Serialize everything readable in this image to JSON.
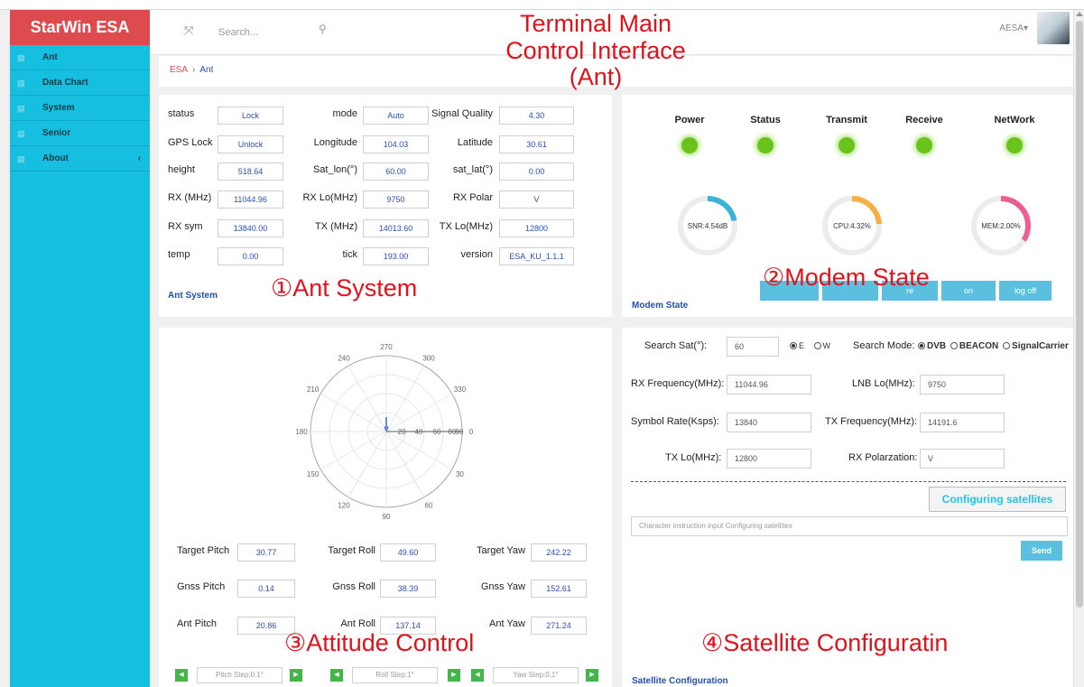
{
  "sidebar": {
    "brand": "StarWin ESA",
    "items": [
      {
        "label": "Ant"
      },
      {
        "label": "Data Chart"
      },
      {
        "label": "System"
      },
      {
        "label": "Senior"
      },
      {
        "label": "About",
        "chevron": "‹"
      }
    ]
  },
  "header": {
    "search_placeholder": "Search...",
    "user": "AESA▾"
  },
  "breadcrumb": {
    "root": "ESA",
    "separator": "›",
    "current": "Ant"
  },
  "annotations": {
    "title_line1": "Terminal Main",
    "title_line2": "Control Interface",
    "title_line3": "(Ant)",
    "ant_system": "①Ant System",
    "modem_state": "②Modem State",
    "attitude_control": "③Attitude Control",
    "satellite_config": "④Satellite Configuratin"
  },
  "ant_system": {
    "title": "Ant System",
    "rows": [
      [
        {
          "label": "status",
          "value": "Lock"
        },
        {
          "label": "mode",
          "value": "Auto"
        },
        {
          "label": "Signal Quality",
          "value": "4.30"
        }
      ],
      [
        {
          "label": "GPS Lock",
          "value": "Unlock"
        },
        {
          "label": "Longitude",
          "value": "104.03"
        },
        {
          "label": "Latitude",
          "value": "30.61"
        }
      ],
      [
        {
          "label": "height",
          "value": "518.64"
        },
        {
          "label": "Sat_lon(°)",
          "value": "60.00"
        },
        {
          "label": "sat_lat(°)",
          "value": "0.00"
        }
      ],
      [
        {
          "label": "RX (MHz)",
          "value": "11044.96"
        },
        {
          "label": "RX Lo(MHz)",
          "value": "9750"
        },
        {
          "label": "RX Polar",
          "value": "V"
        }
      ],
      [
        {
          "label": "RX sym",
          "value": "13840.00"
        },
        {
          "label": "TX (MHz)",
          "value": "14013.60"
        },
        {
          "label": "TX Lo(MHz)",
          "value": "12800"
        }
      ],
      [
        {
          "label": "temp",
          "value": "0.00"
        },
        {
          "label": "tick",
          "value": "193.00"
        },
        {
          "label": "version",
          "value": "ESA_KU_1.1.1"
        }
      ]
    ]
  },
  "modem_state": {
    "title": "Modem State",
    "indicators": [
      "Power",
      "Status",
      "Transmit",
      "Receive",
      "NetWork"
    ],
    "indicator_color": "#6ac31b",
    "gauges": [
      {
        "label": "SNR:4.54dB",
        "fraction": 0.22,
        "color": "#3bb3d8"
      },
      {
        "label": "CPU:4.32%",
        "fraction": 0.24,
        "color": "#f4b042"
      },
      {
        "label": "MEM:2.00%",
        "fraction": 0.34,
        "color": "#ec5f95"
      }
    ],
    "buttons": [
      "",
      "",
      "re",
      "on",
      "log off"
    ]
  },
  "attitude": {
    "polar_angles": [
      "270",
      "300",
      "330",
      "0",
      "30",
      "60",
      "90",
      "120",
      "150",
      "180",
      "210",
      "240"
    ],
    "radial_ticks": [
      "20",
      "40",
      "60",
      "80",
      "90"
    ],
    "rows": [
      [
        {
          "label": "Target Pitch",
          "value": "30.77"
        },
        {
          "label": "Target Roll",
          "value": "49.60"
        },
        {
          "label": "Target Yaw",
          "value": "242.22"
        }
      ],
      [
        {
          "label": "Gnss Pitch",
          "value": "0.14"
        },
        {
          "label": "Gnss Roll",
          "value": "38.39"
        },
        {
          "label": "Gnss Yaw",
          "value": "152.61"
        }
      ],
      [
        {
          "label": "Ant Pitch",
          "value": "20.86"
        },
        {
          "label": "Ant Roll",
          "value": "137.14"
        },
        {
          "label": "Ant Yaw",
          "value": "271.24"
        }
      ]
    ],
    "steppers": [
      "Pitch Step:0.1°",
      "Roll Step:1°",
      "Yaw Step:0.1°"
    ]
  },
  "satellite": {
    "title": "Satellite Configuration",
    "search_sat_label": "Search Sat(°):",
    "search_sat_value": "60",
    "dir_e": "E",
    "dir_w": "W",
    "search_mode_label": "Search Mode:",
    "modes": [
      "DVB",
      "BEACON",
      "SignalCarrier"
    ],
    "rx_freq_label": "RX Frequency(MHz):",
    "rx_freq_value": "11044.96",
    "lnb_lo_label": "LNB Lo(MHz):",
    "lnb_lo_value": "9750",
    "symbol_rate_label": "Symbol Rate(Ksps):",
    "symbol_rate_value": "13840",
    "tx_freq_label": "TX Frequency(MHz):",
    "tx_freq_value": "14191.6",
    "tx_lo_label": "TX Lo(MHz):",
    "tx_lo_value": "12800",
    "rx_polar_label": "RX Polarzation:",
    "rx_polar_value": "V",
    "configure_button": "Configuring satellites",
    "command_placeholder": "Character instruction input Configuring satellites",
    "send_button": "Send"
  }
}
